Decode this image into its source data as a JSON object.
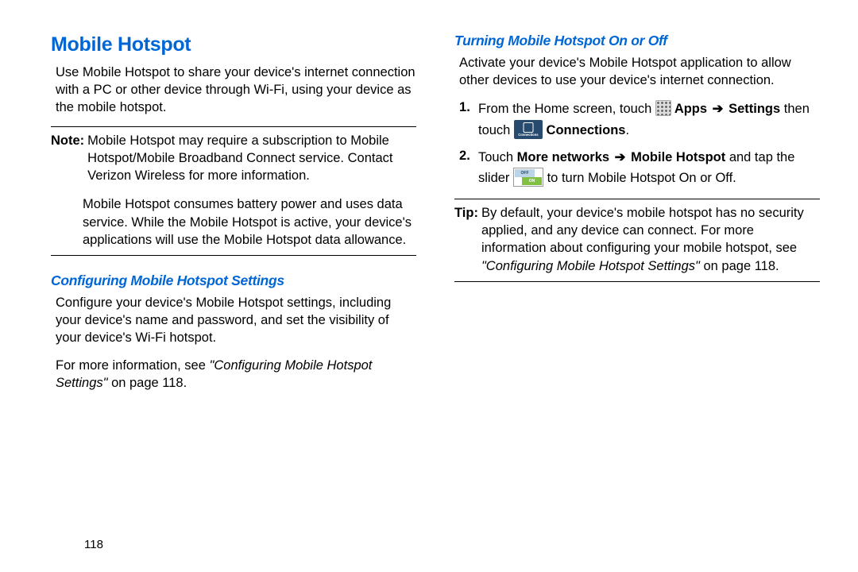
{
  "left": {
    "heading_main": "Mobile Hotspot",
    "intro": "Use Mobile Hotspot to share your device's internet connection with a PC or other device through Wi-Fi, using your device as the mobile hotspot.",
    "note_label": "Note:",
    "note_p1": "Mobile Hotspot may require a subscription to Mobile Hotspot/Mobile Broadband Connect service. Contact Verizon Wireless for more information.",
    "note_p2": "Mobile Hotspot consumes battery power and uses data service. While the Mobile Hotspot is active, your device's applications will use the Mobile Hotspot data allowance.",
    "heading_sub": "Configuring Mobile Hotspot Settings",
    "config_p1": "Configure your device's Mobile Hotspot settings, including your device's name and password, and set the visibility of your device's Wi-Fi hotspot.",
    "config_p2_pre": "For more information, see ",
    "config_p2_xref": "\"Configuring Mobile Hotspot Settings\"",
    "config_p2_post": " on page 118."
  },
  "right": {
    "heading_sub": "Turning Mobile Hotspot On or Off",
    "intro": "Activate your device's Mobile Hotspot application to allow other devices to use your device's internet connection.",
    "step1_pre": "From the Home screen, touch ",
    "step1_apps": " Apps",
    "arrow": " ➔ ",
    "step1_settings": "Settings",
    "step1_then": " then touch ",
    "step1_connections": " Connections",
    "step1_period": ".",
    "step2_pre": "Touch ",
    "step2_more": "More networks ",
    "step2_mh": " Mobile Hotspot",
    "step2_mid": " and tap the slider ",
    "step2_post": " to turn Mobile Hotspot On or Off.",
    "tip_label": "Tip:",
    "tip_body_pre": "By default, your device's mobile hotspot has no security applied, and any device can connect. For more information about configuring your mobile hotspot, see ",
    "tip_xref": "\"Configuring Mobile Hotspot Settings\"",
    "tip_post": " on page 118."
  },
  "page_number": "118"
}
